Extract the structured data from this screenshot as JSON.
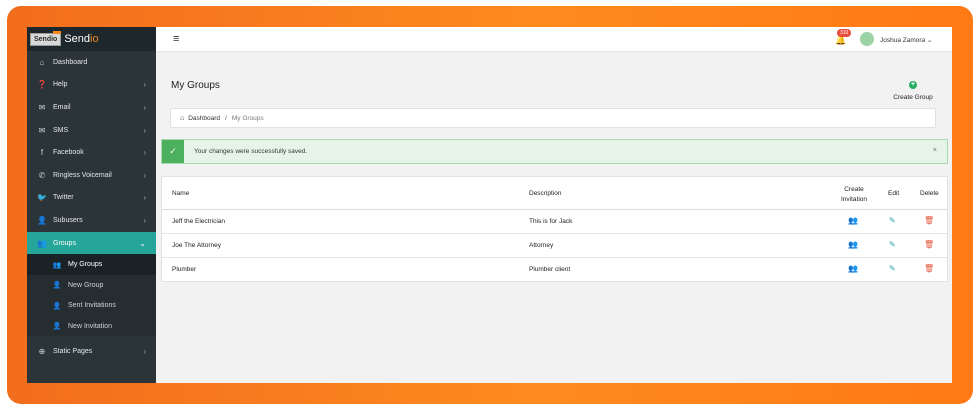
{
  "logo": {
    "box": "Sendio",
    "word_main": "Send",
    "word_accent": "io"
  },
  "sidebar": {
    "items": [
      {
        "label": "Dashboard",
        "icon": "⌂",
        "chevron": ""
      },
      {
        "label": "Help",
        "icon": "❓",
        "chevron": "›"
      },
      {
        "label": "Email",
        "icon": "✉",
        "chevron": "›"
      },
      {
        "label": "SMS",
        "icon": "✉",
        "chevron": "›"
      },
      {
        "label": "Facebook",
        "icon": "f",
        "chevron": "›"
      },
      {
        "label": "Ringless Voicemail",
        "icon": "✆",
        "chevron": "›"
      },
      {
        "label": "Twitter",
        "icon": "🐦",
        "chevron": "›"
      },
      {
        "label": "Subusers",
        "icon": "👤",
        "chevron": "›"
      },
      {
        "label": "Groups",
        "icon": "👥",
        "chevron": "⌄"
      }
    ],
    "groups_sub": [
      {
        "label": "My Groups",
        "icon": "👥"
      },
      {
        "label": "New Group",
        "icon": "👤"
      },
      {
        "label": "Sent Invitations",
        "icon": "👤"
      },
      {
        "label": "New Invitation",
        "icon": "👤"
      }
    ],
    "static_pages": {
      "label": "Static Pages",
      "icon": "⊕",
      "chevron": "›"
    }
  },
  "topbar": {
    "menu_icon": "≡",
    "bell_icon": "🔔",
    "notification_count": "310",
    "user_name": "Joshua Zamora",
    "user_chevron": "⌄"
  },
  "page": {
    "title": "My Groups",
    "create_group_label": "Create Group",
    "create_group_icon": "+"
  },
  "breadcrumb": {
    "home_icon": "⌂",
    "home": "Dashboard",
    "separator": "/",
    "current": "My Groups"
  },
  "alert": {
    "check_icon": "✓",
    "message": "Your changes were successfully saved.",
    "close": "×"
  },
  "table": {
    "headers": {
      "name": "Name",
      "description": "Description",
      "create_invitation_line1": "Create",
      "create_invitation_line2": "Invitation",
      "edit": "Edit",
      "delete": "Delete"
    },
    "rows": [
      {
        "name": "Jeff the Electrician",
        "description": "This is for Jack"
      },
      {
        "name": "Joe The Attorney",
        "description": "Attorney"
      },
      {
        "name": "Plumber",
        "description": "Plumber client"
      }
    ],
    "icons": {
      "invite": "👥",
      "edit": "✎",
      "delete": "🗑"
    }
  },
  "colors": {
    "frame_orange": "#ff8a1e",
    "sidebar_bg": "#2a3439",
    "active_teal": "#26a69a",
    "success_green": "#4cb05e",
    "badge_red": "#e74c3c",
    "delete_red": "#e2553b",
    "action_blue": "#2aa3b8"
  }
}
